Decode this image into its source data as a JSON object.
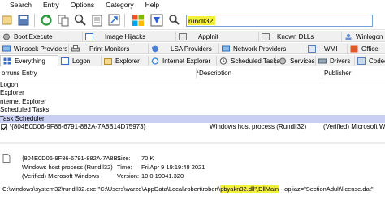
{
  "menu": [
    "Search",
    "Entry",
    "Options",
    "Category",
    "Help"
  ],
  "filter": {
    "value": "rundll32"
  },
  "tabs_row1": [
    "Boot Execute",
    "Image Hijacks",
    "AppInit",
    "Known DLLs",
    "Winlogon"
  ],
  "tabs_row2": [
    "Winsock Providers",
    "Print Monitors",
    "LSA Providers",
    "Network Providers",
    "WMI",
    "Office"
  ],
  "tabs_row3": [
    "Everything",
    "Logon",
    "Explorer",
    "Internet Explorer",
    "Scheduled Tasks",
    "Services",
    "Drivers",
    "Codecs"
  ],
  "columns": {
    "entry": "orruns Entry",
    "description": "Description",
    "publisher": "Publisher"
  },
  "sections": [
    "Logon",
    "Explorer",
    "nternet Explorer",
    "Scheduled Tasks"
  ],
  "task_header": "Task Scheduler",
  "entry": {
    "name": "\\{804E0D06-9F86-6791-882A-7A8B14D75973}",
    "description": "Windows host process (Rundll32)",
    "publisher": "(Verified) Microsoft Windo"
  },
  "details": {
    "name": "{804E0D06-9F86-6791-882A-7A8B1",
    "description": "Windows host process (Rundll32)",
    "publisher": "(Verified) Microsoft Windows",
    "size_label": "Size:",
    "size_value": "70 K",
    "time_label": "Time:",
    "time_value": "Fri Apr 9 19:19:48 2021",
    "version_label": "Version:",
    "version_value": "10.0.19041.320",
    "cmd_pre": "C:\\windows\\system32\\rundll32.exe \"C:\\Users\\warzo\\AppData\\Local\\robert\\robert\\",
    "cmd_hl": "pbyakn32.dll\",DllMain",
    "cmd_post": " --opjiaz=\"SectionAdult\\license.dat\""
  },
  "colors": {
    "highlight": "#f4f13a",
    "task_row": "#c9cff2",
    "filter_border": "#7a9fd6"
  },
  "icons": [
    "open-icon",
    "save-icon",
    "refresh-icon",
    "copy-icon",
    "find-icon",
    "properties-icon",
    "jump-icon",
    "windows-logo-icon",
    "virustotal-icon",
    "scan-icon",
    "filter-icon"
  ]
}
